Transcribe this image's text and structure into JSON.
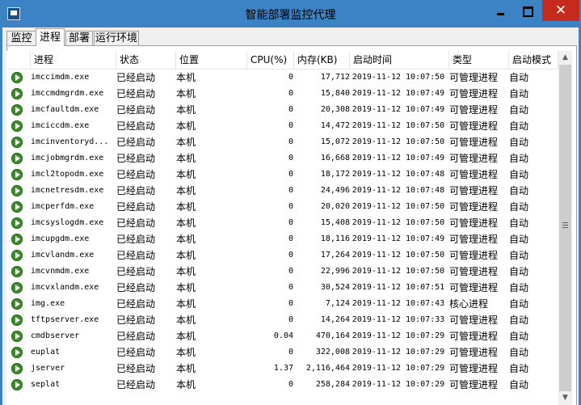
{
  "window": {
    "title": "智能部署监控代理",
    "close_glyph": "✕"
  },
  "tabs": [
    {
      "label": "监控"
    },
    {
      "label": "进程"
    },
    {
      "label": "部署"
    },
    {
      "label": "运行环境"
    }
  ],
  "active_tab": "进程",
  "columns": {
    "name": "进程",
    "status": "状态",
    "location": "位置",
    "cpu": "CPU(%)",
    "memory": "内存(KB)",
    "start_time": "启动时间",
    "type": "类型",
    "start_mode": "启动模式"
  },
  "rows": [
    {
      "name": "imccimdm.exe",
      "status": "已经启动",
      "location": "本机",
      "cpu": "0",
      "memory": "17,712",
      "start_time": "2019-11-12 10:07:50",
      "type": "可管理进程",
      "start_mode": "自动"
    },
    {
      "name": "imccmdmgrdm.exe",
      "status": "已经启动",
      "location": "本机",
      "cpu": "0",
      "memory": "15,840",
      "start_time": "2019-11-12 10:07:49",
      "type": "可管理进程",
      "start_mode": "自动"
    },
    {
      "name": "imcfaultdm.exe",
      "status": "已经启动",
      "location": "本机",
      "cpu": "0",
      "memory": "20,308",
      "start_time": "2019-11-12 10:07:49",
      "type": "可管理进程",
      "start_mode": "自动"
    },
    {
      "name": "imciccdm.exe",
      "status": "已经启动",
      "location": "本机",
      "cpu": "0",
      "memory": "14,472",
      "start_time": "2019-11-12 10:07:50",
      "type": "可管理进程",
      "start_mode": "自动"
    },
    {
      "name": "imcinventoryd...",
      "status": "已经启动",
      "location": "本机",
      "cpu": "0",
      "memory": "15,072",
      "start_time": "2019-11-12 10:07:50",
      "type": "可管理进程",
      "start_mode": "自动"
    },
    {
      "name": "imcjobmgrdm.exe",
      "status": "已经启动",
      "location": "本机",
      "cpu": "0",
      "memory": "16,668",
      "start_time": "2019-11-12 10:07:49",
      "type": "可管理进程",
      "start_mode": "自动"
    },
    {
      "name": "imcl2topodm.exe",
      "status": "已经启动",
      "location": "本机",
      "cpu": "0",
      "memory": "18,172",
      "start_time": "2019-11-12 10:07:48",
      "type": "可管理进程",
      "start_mode": "自动"
    },
    {
      "name": "imcnetresdm.exe",
      "status": "已经启动",
      "location": "本机",
      "cpu": "0",
      "memory": "24,496",
      "start_time": "2019-11-12 10:07:48",
      "type": "可管理进程",
      "start_mode": "自动"
    },
    {
      "name": "imcperfdm.exe",
      "status": "已经启动",
      "location": "本机",
      "cpu": "0",
      "memory": "20,020",
      "start_time": "2019-11-12 10:07:50",
      "type": "可管理进程",
      "start_mode": "自动"
    },
    {
      "name": "imcsyslogdm.exe",
      "status": "已经启动",
      "location": "本机",
      "cpu": "0",
      "memory": "15,408",
      "start_time": "2019-11-12 10:07:50",
      "type": "可管理进程",
      "start_mode": "自动"
    },
    {
      "name": "imcupgdm.exe",
      "status": "已经启动",
      "location": "本机",
      "cpu": "0",
      "memory": "18,116",
      "start_time": "2019-11-12 10:07:49",
      "type": "可管理进程",
      "start_mode": "自动"
    },
    {
      "name": "imcvlandm.exe",
      "status": "已经启动",
      "location": "本机",
      "cpu": "0",
      "memory": "17,264",
      "start_time": "2019-11-12 10:07:50",
      "type": "可管理进程",
      "start_mode": "自动"
    },
    {
      "name": "imcvnmdm.exe",
      "status": "已经启动",
      "location": "本机",
      "cpu": "0",
      "memory": "22,996",
      "start_time": "2019-11-12 10:07:50",
      "type": "可管理进程",
      "start_mode": "自动"
    },
    {
      "name": "imcvxlandm.exe",
      "status": "已经启动",
      "location": "本机",
      "cpu": "0",
      "memory": "30,524",
      "start_time": "2019-11-12 10:07:51",
      "type": "可管理进程",
      "start_mode": "自动"
    },
    {
      "name": "img.exe",
      "status": "已经启动",
      "location": "本机",
      "cpu": "0",
      "memory": "7,124",
      "start_time": "2019-11-12 10:07:43",
      "type": "核心进程",
      "start_mode": "自动"
    },
    {
      "name": "tftpserver.exe",
      "status": "已经启动",
      "location": "本机",
      "cpu": "0",
      "memory": "14,264",
      "start_time": "2019-11-12 10:07:33",
      "type": "可管理进程",
      "start_mode": "自动"
    },
    {
      "name": "cmdbserver",
      "status": "已经启动",
      "location": "本机",
      "cpu": "0.04",
      "memory": "470,164",
      "start_time": "2019-11-12 10:07:29",
      "type": "可管理进程",
      "start_mode": "自动"
    },
    {
      "name": "euplat",
      "status": "已经启动",
      "location": "本机",
      "cpu": "0",
      "memory": "322,008",
      "start_time": "2019-11-12 10:07:29",
      "type": "可管理进程",
      "start_mode": "自动"
    },
    {
      "name": "jserver",
      "status": "已经启动",
      "location": "本机",
      "cpu": "1.37",
      "memory": "2,116,464",
      "start_time": "2019-11-12 10:07:29",
      "type": "可管理进程",
      "start_mode": "自动"
    },
    {
      "name": "seplat",
      "status": "已经启动",
      "location": "本机",
      "cpu": "0",
      "memory": "258,284",
      "start_time": "2019-11-12 10:07:29",
      "type": "可管理进程",
      "start_mode": "自动"
    }
  ],
  "icons": {
    "row_status": "running-play-icon",
    "app": "app-icon"
  },
  "colors": {
    "title_bar": "#3b83c4",
    "close_button": "#c42b1c",
    "running_icon": "#3d8a2c"
  }
}
